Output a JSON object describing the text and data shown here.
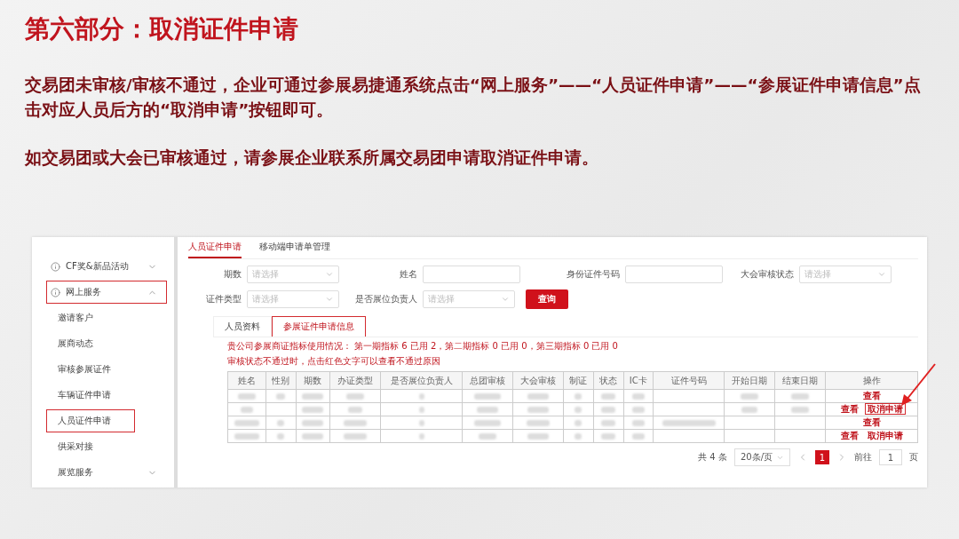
{
  "slide": {
    "title": "第六部分：取消证件申请",
    "paragraphs": [
      "交易团未审核/审核不通过，企业可通过参展易捷通系统点击“网上服务”——“人员证件申请”——“参展证件申请信息”点击对应人员后方的“取消申请”按钮即可。",
      "如交易团或大会已审核通过，请参展企业联系所属交易团申请取消证件申请。"
    ]
  },
  "sidebar": {
    "items": [
      {
        "label": "CF奖&新品活动",
        "kind": "group",
        "expanded": false,
        "highlighted": false
      },
      {
        "label": "网上服务",
        "kind": "group",
        "expanded": true,
        "highlighted": true
      },
      {
        "label": "邀请客户",
        "kind": "sub",
        "highlighted": false
      },
      {
        "label": "展商动态",
        "kind": "sub",
        "highlighted": false
      },
      {
        "label": "审核参展证件",
        "kind": "sub",
        "highlighted": false
      },
      {
        "label": "车辆证件申请",
        "kind": "sub",
        "highlighted": false
      },
      {
        "label": "人员证件申请",
        "kind": "sub",
        "highlighted": true
      },
      {
        "label": "供采对接",
        "kind": "sub",
        "highlighted": false
      },
      {
        "label": "展览服务",
        "kind": "sub-group",
        "expanded": false,
        "highlighted": false
      }
    ]
  },
  "tabs": [
    {
      "label": "人员证件申请",
      "selected": true
    },
    {
      "label": "移动端申请单管理",
      "selected": false
    }
  ],
  "filters": [
    [
      {
        "label": "期数",
        "kind": "select",
        "placeholder": "请选择"
      },
      {
        "label": "姓名",
        "kind": "input"
      },
      {
        "label": "身份证件号码",
        "kind": "input"
      },
      {
        "label": "大会审核状态",
        "kind": "select",
        "placeholder": "请选择"
      }
    ],
    [
      {
        "label": "证件类型",
        "kind": "select",
        "placeholder": "请选择"
      },
      {
        "label": "是否展位负责人",
        "kind": "select",
        "placeholder": "请选择"
      },
      {
        "label": "查询",
        "kind": "button"
      }
    ]
  ],
  "sub_tabs": [
    {
      "label": "人员资料",
      "selected": false,
      "highlighted": false
    },
    {
      "label": "参展证件申请信息",
      "selected": true,
      "highlighted": true
    }
  ],
  "notices": [
    "贵公司参展商证指标使用情况：  第一期指标 6 已用 2，第二期指标 0 已用 0，第三期指标 0 已用 0",
    "审核状态不通过时，点击红色文字可以查看不通过原因"
  ],
  "table": {
    "columns": [
      "姓名",
      "性别",
      "期数",
      "办证类型",
      "是否展位负责人",
      "总团审核",
      "大会审核",
      "制证",
      "状态",
      "IC卡",
      "证件号码",
      "开始日期",
      "结束日期",
      "操作"
    ],
    "rows": [
      {
        "actions": [
          {
            "label": "查看",
            "highlighted": false
          }
        ]
      },
      {
        "actions": [
          {
            "label": "查看",
            "highlighted": false
          },
          {
            "label": "取消申请",
            "highlighted": true
          }
        ]
      },
      {
        "actions": [
          {
            "label": "查看",
            "highlighted": false
          }
        ]
      },
      {
        "actions": [
          {
            "label": "查看",
            "highlighted": false
          },
          {
            "label": "取消申请",
            "highlighted": false
          }
        ]
      }
    ]
  },
  "pagination": {
    "total": "共 4 条",
    "page_size": "20条/页",
    "pages": [
      {
        "label": "1",
        "selected": true
      }
    ],
    "goto_label": "前往",
    "goto_value": "1",
    "goto_suffix": "页"
  }
}
